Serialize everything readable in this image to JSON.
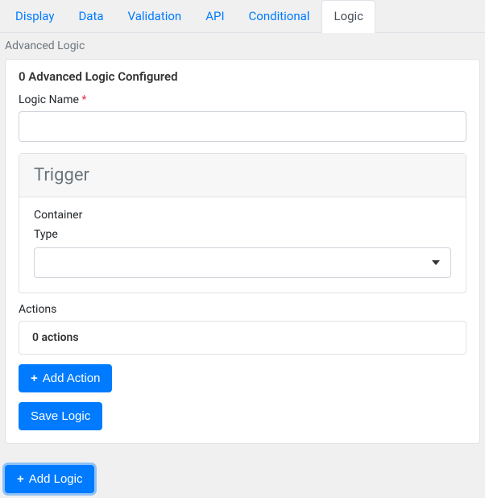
{
  "tabs": {
    "items": [
      {
        "label": "Display",
        "active": false
      },
      {
        "label": "Data",
        "active": false
      },
      {
        "label": "Validation",
        "active": false
      },
      {
        "label": "API",
        "active": false
      },
      {
        "label": "Conditional",
        "active": false
      },
      {
        "label": "Logic",
        "active": true
      }
    ]
  },
  "section": {
    "label": "Advanced Logic"
  },
  "panel": {
    "header": "0 Advanced Logic Configured",
    "logicName": {
      "label": "Logic Name",
      "required": "*",
      "value": ""
    },
    "trigger": {
      "title": "Trigger",
      "containerLabel": "Container",
      "typeLabel": "Type",
      "typeValue": ""
    },
    "actions": {
      "label": "Actions",
      "summary": "0 actions",
      "addButton": "Add Action"
    },
    "saveButton": "Save Logic"
  },
  "footer": {
    "addLogicButton": "Add Logic"
  },
  "icons": {
    "plus": "+"
  }
}
